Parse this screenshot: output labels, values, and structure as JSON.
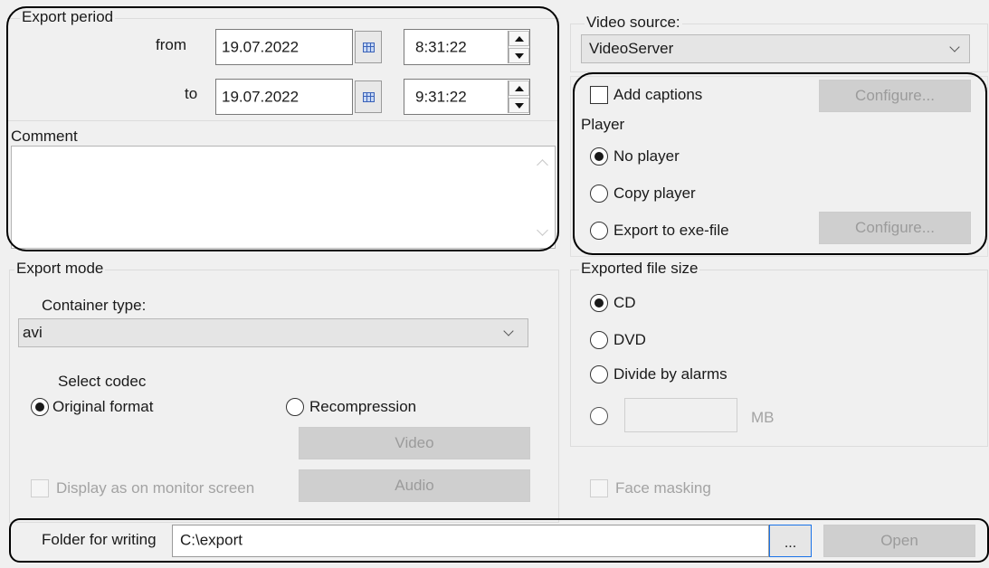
{
  "export_period": {
    "title": "Export period",
    "from_label": "from",
    "from_date": "19.07.2022",
    "from_time": "8:31:22",
    "to_label": "to",
    "to_date": "19.07.2022",
    "to_time": "9:31:22"
  },
  "comment": {
    "label": "Comment",
    "value": ""
  },
  "video_source": {
    "label": "Video source:",
    "selected": "VideoServer"
  },
  "captions": {
    "checkbox_label": "Add captions",
    "checked": false,
    "configure_label": "Configure..."
  },
  "player": {
    "label": "Player",
    "options": [
      "No player",
      "Copy player",
      "Export to exe-file"
    ],
    "selected": "No player",
    "configure_label": "Configure..."
  },
  "export_mode": {
    "title": "Export mode",
    "container_label": "Container type:",
    "container_value": "avi",
    "codec_label": "Select codec",
    "codec_options": [
      "Original format",
      "Recompression"
    ],
    "codec_selected": "Original format",
    "video_button": "Video",
    "audio_button": "Audio",
    "display_checkbox": "Display as on monitor screen"
  },
  "file_size": {
    "title": "Exported file size",
    "options": [
      "CD",
      "DVD",
      "Divide by alarms"
    ],
    "selected": "CD",
    "custom_value": "",
    "unit": "MB"
  },
  "face_masking": {
    "label": "Face masking",
    "checked": false
  },
  "folder": {
    "label": "Folder for writing",
    "path": "C:\\export",
    "browse_label": "...",
    "open_label": "Open"
  }
}
